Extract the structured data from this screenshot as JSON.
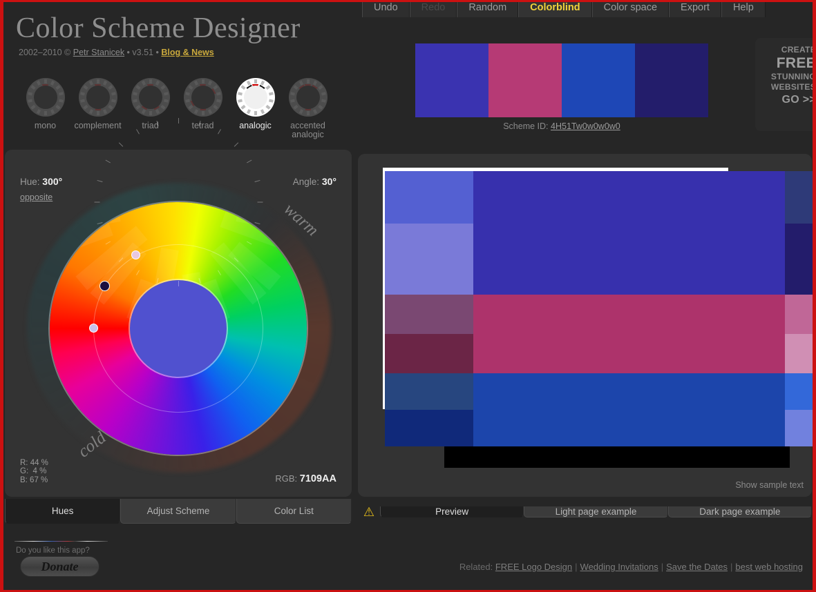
{
  "topmenu": {
    "items": [
      {
        "label": "Undo",
        "state": "normal"
      },
      {
        "label": "Redo",
        "state": "disabled"
      },
      {
        "label": "Random",
        "state": "normal"
      },
      {
        "label": "Colorblind",
        "state": "active"
      },
      {
        "label": "Color space",
        "state": "normal"
      },
      {
        "label": "Export",
        "state": "normal"
      },
      {
        "label": "Help",
        "state": "normal"
      }
    ]
  },
  "header": {
    "title": "Color Scheme Designer",
    "copyright": "2002–2010 © ",
    "author": "Petr Stanicek",
    "version_sep": " • ",
    "version": "v3.51",
    "blog_sep": " • ",
    "blog": "Blog & News"
  },
  "schemes": {
    "items": [
      {
        "label": "mono",
        "active": false,
        "wedges": [
          0
        ]
      },
      {
        "label": "complement",
        "active": false,
        "wedges": [
          0,
          180
        ]
      },
      {
        "label": "triad",
        "active": false,
        "wedges": [
          0,
          150,
          210
        ]
      },
      {
        "label": "tetrad",
        "active": false,
        "wedges": [
          0,
          60,
          180,
          240
        ]
      },
      {
        "label": "analogic",
        "active": true,
        "wedges": [
          0,
          -32,
          32
        ]
      },
      {
        "label": "accented analogic",
        "active": false,
        "wedges": [
          0,
          -32,
          32,
          180
        ]
      }
    ]
  },
  "swatches": {
    "colors": [
      "#3a33b0",
      "#b63a75",
      "#1e47b6",
      "#231d6b"
    ],
    "scheme_id_label": "Scheme ID:",
    "scheme_id": "4H51Tw0w0w0w0"
  },
  "ad": {
    "line1": "CREATE",
    "line2": "FREE",
    "line3": "STUNNING",
    "line4": "WEBSITES",
    "line5": "GO >>"
  },
  "left_panel": {
    "hue_label": "Hue:",
    "hue_value": "300°",
    "opposite": "opposite",
    "angle_label": "Angle:",
    "angle_value": "30°",
    "rgb_percent": "R: 44 %\nG:  4 %\nB: 67 %",
    "rgb_label": "RGB:",
    "rgb_hex": "7109AA",
    "word_warm": "warm",
    "word_cold": "cold",
    "inner_color": "#5051cf",
    "handles": [
      {
        "name": "main-handle",
        "angle_deg": 300,
        "radius": 122,
        "color": "#1c1040"
      },
      {
        "name": "secondary-handle",
        "angle_deg": 330,
        "radius": 122,
        "color": "#e8c8e0"
      },
      {
        "name": "tertiary-handle",
        "angle_deg": 270,
        "radius": 122,
        "color": "#c9c0ea"
      }
    ]
  },
  "preview": {
    "cells": [
      {
        "name": "cell-r1c1",
        "color": "#5460d2"
      },
      {
        "name": "cell-main-big",
        "color": "#3730ad"
      },
      {
        "name": "cell-r1c3",
        "color": "#2e3a78"
      },
      {
        "name": "cell-r2c1",
        "color": "#7a7ad8"
      },
      {
        "name": "cell-r2c3",
        "color": "#231c6b"
      },
      {
        "name": "cell-r3c1",
        "color": "#7a4872"
      },
      {
        "name": "cell-pink-big",
        "color": "#ad336b"
      },
      {
        "name": "cell-r3c3",
        "color": "#c06797"
      },
      {
        "name": "cell-r4c1",
        "color": "#6b2546"
      },
      {
        "name": "cell-r4c3",
        "color": "#d08fb4"
      },
      {
        "name": "cell-r5c1",
        "color": "#27467f"
      },
      {
        "name": "cell-blue-big",
        "color": "#1c45ab"
      },
      {
        "name": "cell-r5c3",
        "color": "#3368d9"
      },
      {
        "name": "cell-r6c1",
        "color": "#10297a"
      },
      {
        "name": "cell-r6c3",
        "color": "#7181de"
      }
    ],
    "show_sample_text": "Show sample text"
  },
  "left_tabs": {
    "items": [
      {
        "label": "Hues",
        "active": true
      },
      {
        "label": "Adjust Scheme",
        "active": false
      },
      {
        "label": "Color List",
        "active": false
      }
    ]
  },
  "right_tabs": {
    "warning_icon": "warning-triangle",
    "items": [
      {
        "label": "Preview",
        "active": true
      },
      {
        "label": "Light page example",
        "active": false
      },
      {
        "label": "Dark page example",
        "active": false
      }
    ]
  },
  "footer": {
    "like_text": "Do you like this app?",
    "donate_label": "Donate",
    "related_label": "Related:",
    "related_links": [
      "FREE Logo Design",
      "Wedding Invitations",
      "Save the Dates",
      "best web hosting"
    ]
  }
}
